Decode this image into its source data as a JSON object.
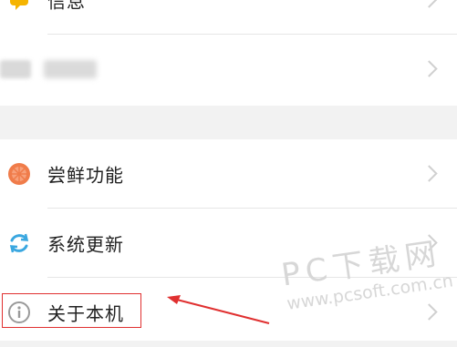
{
  "rows_top": [
    {
      "label": "信息",
      "icon": "message-icon"
    },
    {
      "label": "",
      "icon": "blurred-icon"
    }
  ],
  "rows_bottom": [
    {
      "label": "尝鲜功能",
      "icon": "orange-slice-icon"
    },
    {
      "label": "系统更新",
      "icon": "refresh-icon"
    },
    {
      "label": "关于本机",
      "icon": "info-icon"
    }
  ],
  "watermark": {
    "title": "PC下载网",
    "url": "www.pcsoft.com.cn"
  },
  "colors": {
    "accent_orange": "#f07c4a",
    "accent_blue": "#3aa7e0",
    "info_gray": "#9a9a9a",
    "highlight_red": "#e03030"
  }
}
